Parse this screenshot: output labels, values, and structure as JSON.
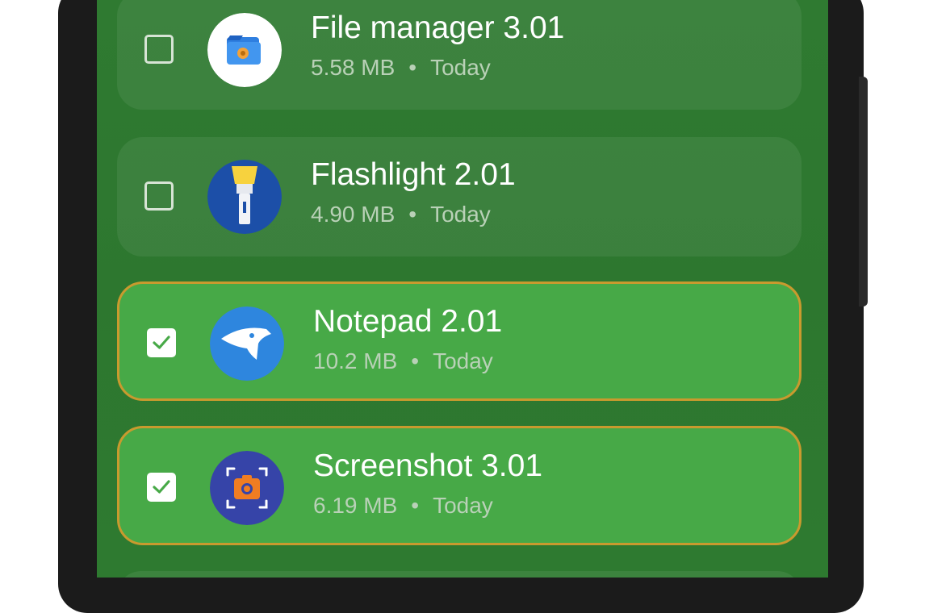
{
  "apps": [
    {
      "name": "File manager 3.01",
      "size": "5.58 MB",
      "date": "Today",
      "separator": "•",
      "selected": false,
      "icon": "file-manager-icon"
    },
    {
      "name": "Flashlight 2.01",
      "size": "4.90 MB",
      "date": "Today",
      "separator": "•",
      "selected": false,
      "icon": "flashlight-icon"
    },
    {
      "name": "Notepad 2.01",
      "size": "10.2 MB",
      "date": "Today",
      "separator": "•",
      "selected": true,
      "icon": "notepad-icon"
    },
    {
      "name": "Screenshot 3.01",
      "size": "6.19 MB",
      "date": "Today",
      "separator": "•",
      "selected": true,
      "icon": "screenshot-icon"
    }
  ],
  "colors": {
    "background": "#2e7a30",
    "selected_row": "#47a947",
    "selected_border": "#c99a2e",
    "text_primary": "#ffffff",
    "text_secondary": "#b9d1b7"
  }
}
